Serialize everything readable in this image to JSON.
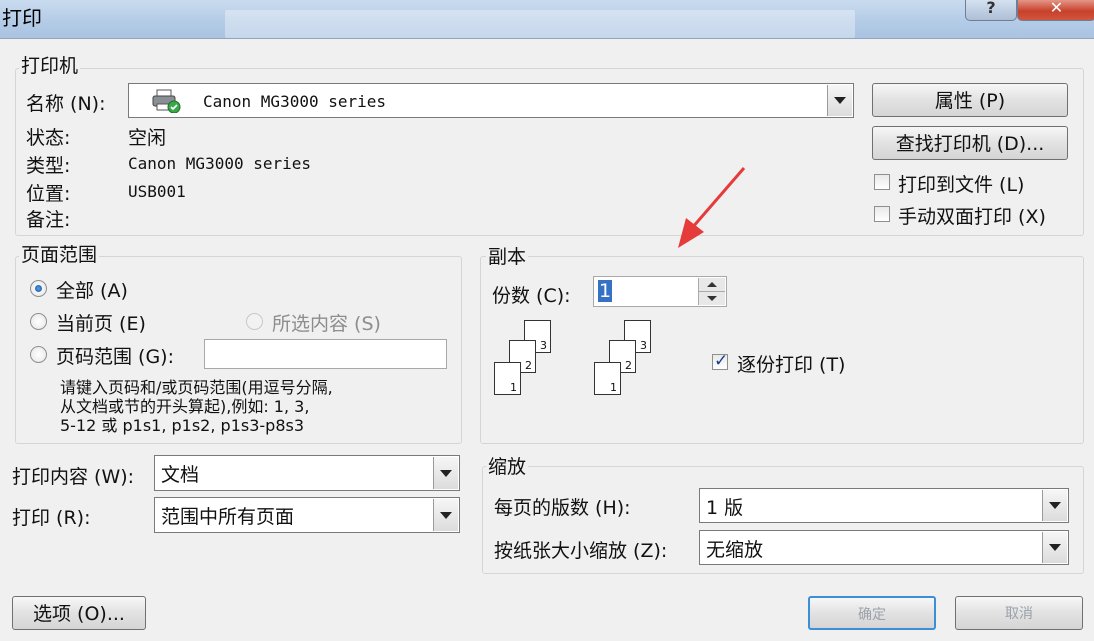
{
  "window": {
    "title": "打印",
    "help_icon": "?",
    "close_icon": "✕"
  },
  "printer": {
    "group_label": "打印机",
    "name_label": "名称 (N):",
    "name_value": "Canon MG3000 series",
    "status_label": "状态:",
    "status_value": "空闲",
    "type_label": "类型:",
    "type_value": "Canon MG3000 series",
    "location_label": "位置:",
    "location_value": "USB001",
    "comment_label": "备注:",
    "properties_button": "属性 (P)",
    "find_printer_button": "查找打印机 (D)...",
    "print_to_file_label": "打印到文件 (L)",
    "print_to_file_checked": false,
    "manual_duplex_label": "手动双面打印 (X)",
    "manual_duplex_checked": false
  },
  "page_range": {
    "group_label": "页面范围",
    "all_label": "全部 (A)",
    "current_label": "当前页 (E)",
    "selection_label": "所选内容 (S)",
    "pages_label": "页码范围 (G):",
    "pages_value": "",
    "selected": "all",
    "hint": "请键入页码和/或页码范围(用逗号分隔,\n从文档或节的开头算起),例如: 1, 3,\n5-12 或 p1s1, p1s2, p1s3-p8s3"
  },
  "copies": {
    "group_label": "副本",
    "count_label": "份数 (C):",
    "count_value": "1",
    "collate_label": "逐份打印 (T)",
    "collate_checked": true,
    "page_numbers": [
      "1",
      "2",
      "3"
    ]
  },
  "print_what": {
    "content_label": "打印内容 (W):",
    "content_value": "文档",
    "print_label": "打印 (R):",
    "print_value": "范围中所有页面"
  },
  "zoom": {
    "group_label": "缩放",
    "pages_per_sheet_label": "每页的版数 (H):",
    "pages_per_sheet_value": "1 版",
    "scale_label": "按纸张大小缩放 (Z):",
    "scale_value": "无缩放"
  },
  "footer": {
    "options_button": "选项 (O)...",
    "ok_button": "确定",
    "cancel_button": "取消"
  },
  "annotation": {
    "arrow_color": "#e53b3b"
  },
  "icons": [
    "printer-icon",
    "help-icon",
    "close-icon",
    "spinner-up-icon",
    "spinner-down-icon",
    "chevron-down-icon"
  ]
}
